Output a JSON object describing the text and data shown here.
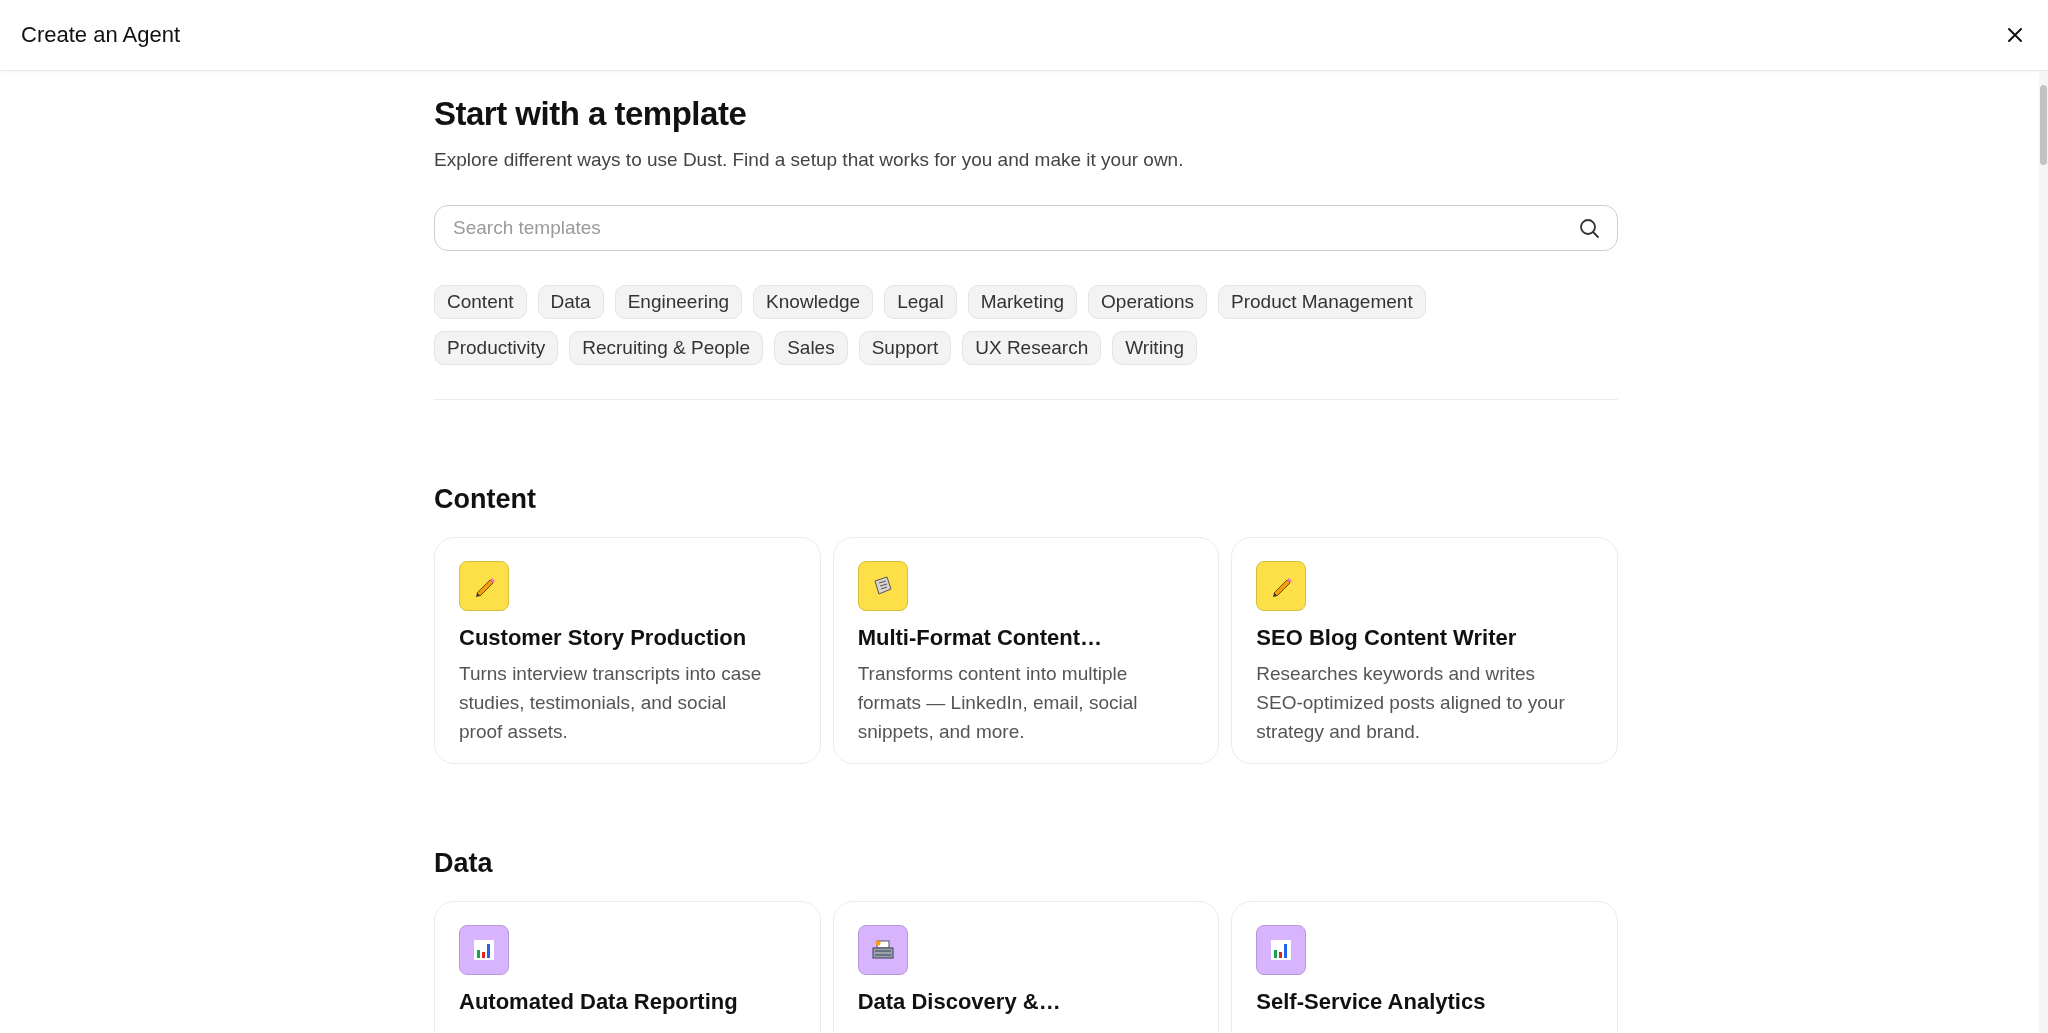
{
  "window": {
    "title": "Create an Agent"
  },
  "heading": "Start with a template",
  "subtitle": "Explore different ways to use Dust. Find a setup that works for you and make it your own.",
  "search": {
    "placeholder": "Search templates"
  },
  "filters": [
    "Content",
    "Data",
    "Engineering",
    "Knowledge",
    "Legal",
    "Marketing",
    "Operations",
    "Product Management",
    "Productivity",
    "Recruiting & People",
    "Sales",
    "Support",
    "UX Research",
    "Writing"
  ],
  "sections": [
    {
      "title": "Content",
      "color": "#fde047",
      "cards": [
        {
          "kind": "pencil",
          "title": "Customer Story Production",
          "description": "Turns interview transcripts into case studies, testimonials, and social proof assets."
        },
        {
          "kind": "newspaper",
          "title": "Multi-Format Content…",
          "description": "Transforms content into multiple formats — LinkedIn, email, social snippets, and more."
        },
        {
          "kind": "pencil",
          "title": "SEO Blog Content Writer",
          "description": "Researches keywords and writes SEO-optimized posts aligned to your strategy and brand."
        }
      ]
    },
    {
      "title": "Data",
      "color": "#d8b4fe",
      "cards": [
        {
          "kind": "chart",
          "title": "Automated Data Reporting"
        },
        {
          "kind": "cabinet",
          "title": "Data Discovery &…"
        },
        {
          "kind": "chart",
          "title": "Self-Service Analytics"
        }
      ]
    }
  ]
}
